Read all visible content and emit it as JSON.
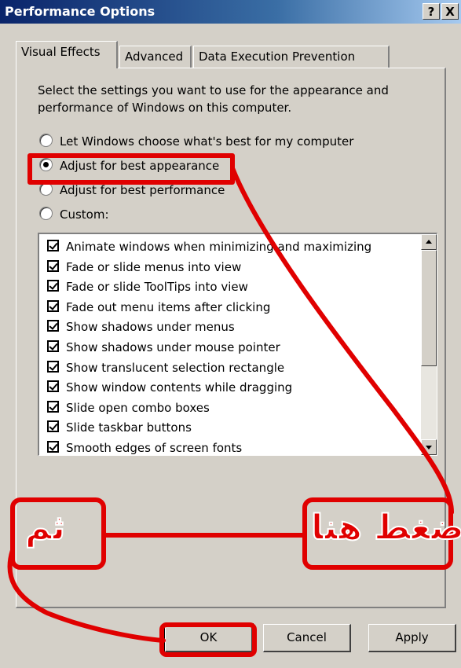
{
  "window": {
    "title": "Performance Options"
  },
  "title_buttons": {
    "help": "?",
    "close": "X"
  },
  "tabs": [
    {
      "label": "Visual Effects"
    },
    {
      "label": "Advanced"
    },
    {
      "label": "Data Execution Prevention"
    }
  ],
  "description": "Select the settings you want to use for the appearance and performance of Windows on this computer.",
  "radios": [
    {
      "label": "Let Windows choose what's best for my computer",
      "selected": false
    },
    {
      "label": "Adjust for best appearance",
      "selected": true
    },
    {
      "label": "Adjust for best performance",
      "selected": false
    },
    {
      "label": "Custom:",
      "selected": false
    }
  ],
  "effects": [
    "Animate windows when minimizing and maximizing",
    "Fade or slide menus into view",
    "Fade or slide ToolTips into view",
    "Fade out menu items after clicking",
    "Show shadows under menus",
    "Show shadows under mouse pointer",
    "Show translucent selection rectangle",
    "Show window contents while dragging",
    "Slide open combo boxes",
    "Slide taskbar buttons",
    "Smooth edges of screen fonts"
  ],
  "buttons": {
    "ok": "OK",
    "cancel": "Cancel",
    "apply": "Apply"
  },
  "annotations": {
    "click_here": "إضغط هنا",
    "then": "ثم"
  },
  "colors": {
    "annotation": "#e00000",
    "titlebar_start": "#0a246a",
    "face": "#d4d0c8"
  }
}
